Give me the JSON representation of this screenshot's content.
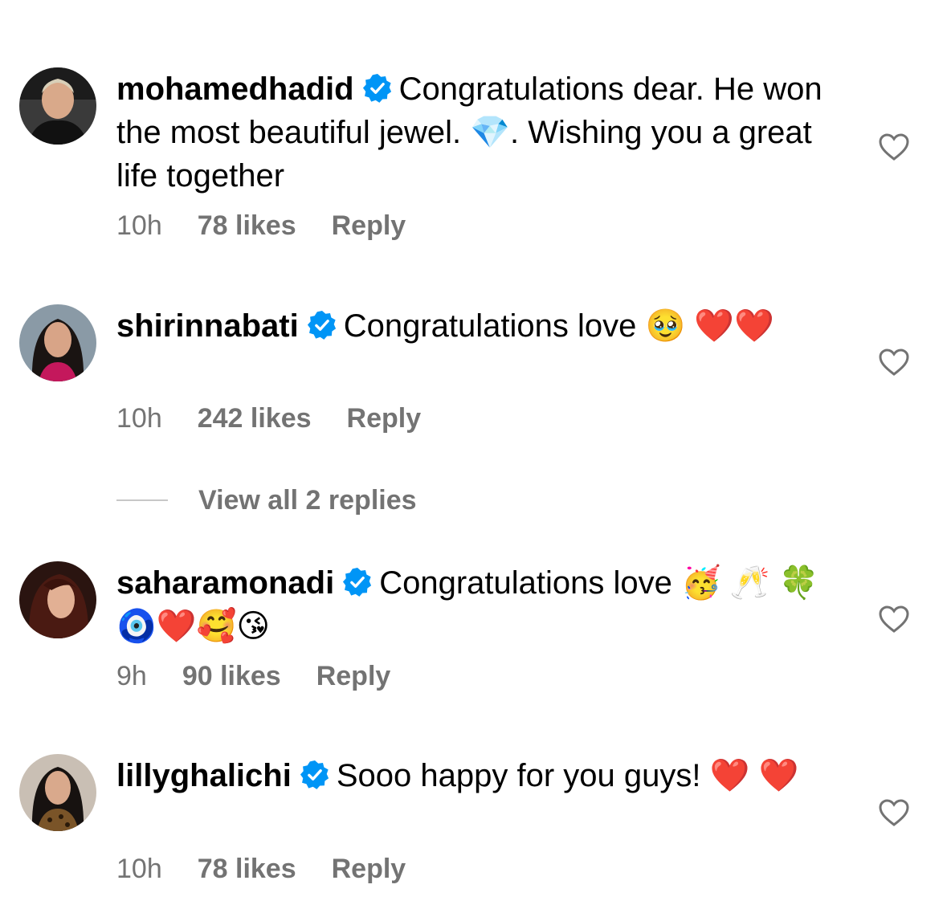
{
  "colors": {
    "verified_blue": "#0095f6",
    "secondary_text": "#737373",
    "divider": "#c7c7c7"
  },
  "comments": [
    {
      "username": "mohamedhadid",
      "verified": true,
      "text": "Congratulations dear. He won the most beautiful jewel. 💎. Wishing you a great life together",
      "time": "10h",
      "likes": "78 likes",
      "reply": "Reply"
    },
    {
      "username": "shirinnabati",
      "verified": true,
      "text": "Congratulations love 🥹 ❤️❤️",
      "time": "10h",
      "likes": "242 likes",
      "reply": "Reply"
    },
    {
      "username": "saharamonadi",
      "verified": true,
      "text": "Congratulations love 🥳 🥂 🍀 🧿❤️🥰😘",
      "time": "9h",
      "likes": "90 likes",
      "reply": "Reply"
    },
    {
      "username": "lillyghalichi",
      "verified": true,
      "text": "Sooo happy for you guys! ❤️ ❤️",
      "time": "10h",
      "likes": "78 likes",
      "reply": "Reply"
    }
  ],
  "view_replies": "View all 2 replies",
  "icons": {
    "verified": "verified-badge-icon",
    "like": "heart-outline-icon"
  }
}
